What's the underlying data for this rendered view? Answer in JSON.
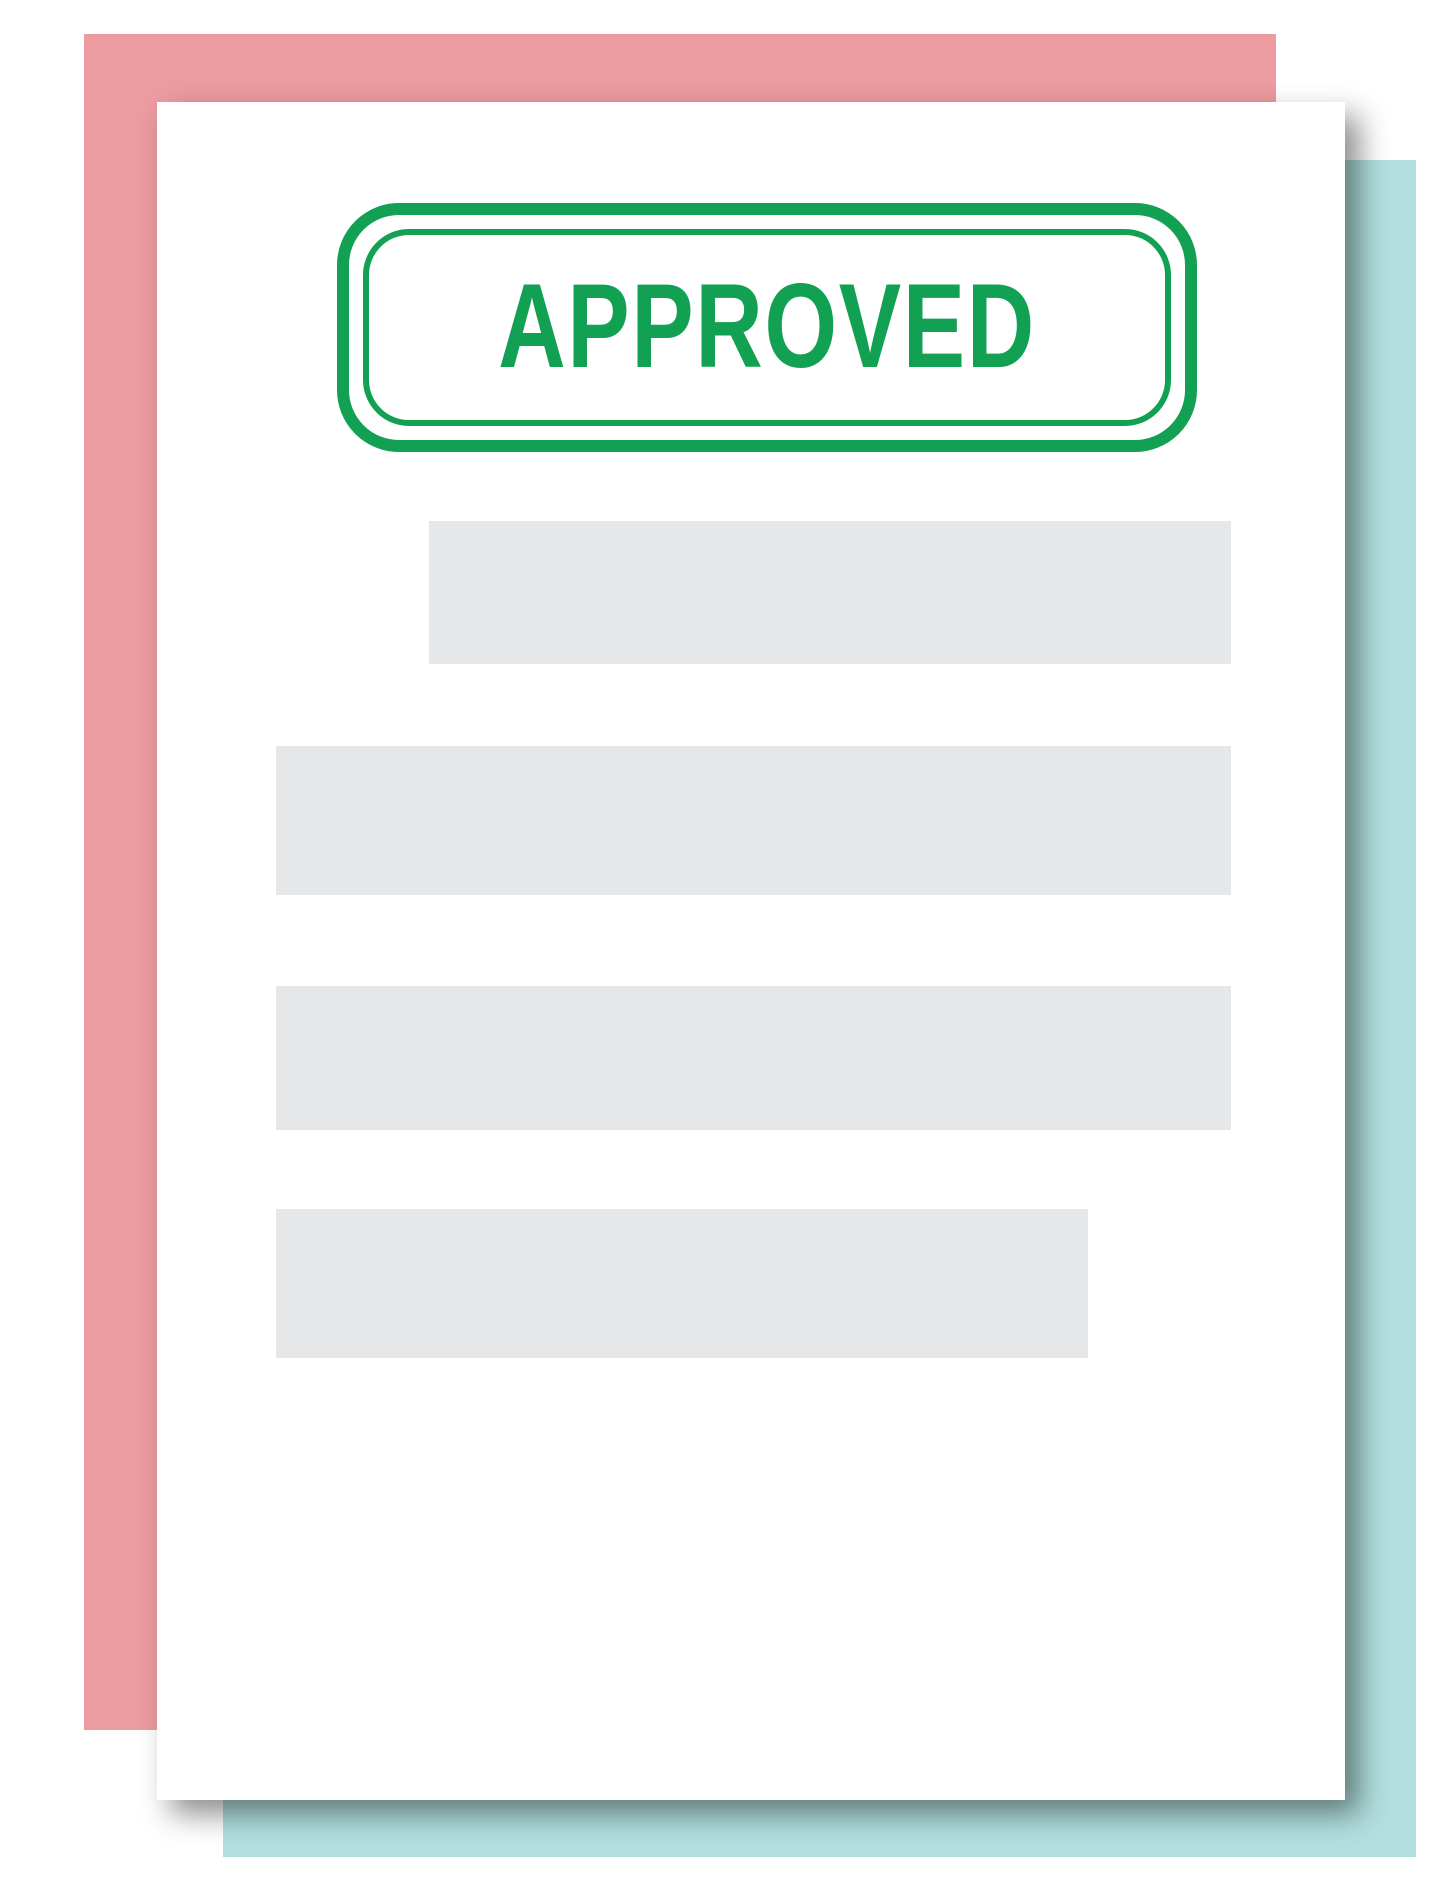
{
  "stamp": {
    "text": "APPROVED",
    "color": "#12a152"
  },
  "colors": {
    "back_sheet_pink": "#ec9ba0",
    "back_sheet_teal": "#b2e0df",
    "front_sheet": "#ffffff",
    "text_placeholder": "#e6e7e8"
  },
  "document": {
    "placeholder_line_count": 4
  }
}
